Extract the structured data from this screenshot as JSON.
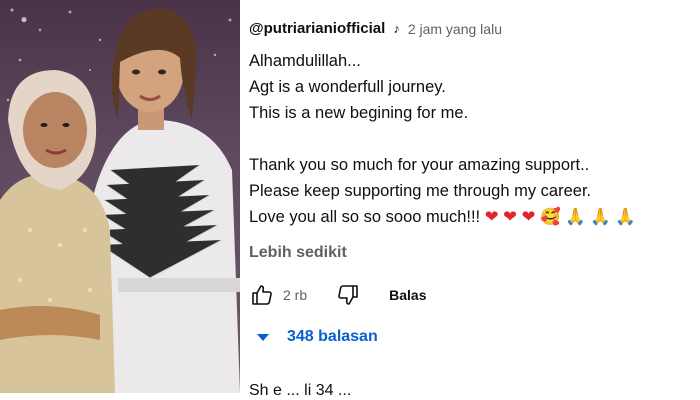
{
  "comment": {
    "username": "@putriarianiofficial",
    "timestamp": "2 jam yang lalu",
    "lines": [
      "Alhamdulillah...",
      "Agt is a wonderfull journey.",
      "This is a new begining for me.",
      "",
      "Thank you so much for your amazing support..",
      "Please keep supporting me through my career.",
      "Love you all so so sooo much!!!"
    ],
    "emoji_trail": [
      "❤",
      "❤",
      "❤",
      "🥰",
      "🙏",
      "🙏",
      "🙏"
    ],
    "show_less_label": "Lebih sedikit",
    "like_count": "2 rb",
    "reply_label": "Balas",
    "replies_label": "348 balasan",
    "next_comment_partial": "Sh         e     ...     li    34    ..."
  },
  "icons": {
    "note": "music-note-icon",
    "like": "thumbs-up-icon",
    "dislike": "thumbs-down-icon",
    "expand": "caret-down-icon"
  },
  "colors": {
    "text": "#0f0f0f",
    "secondary": "#606060",
    "link": "#065fd4"
  }
}
